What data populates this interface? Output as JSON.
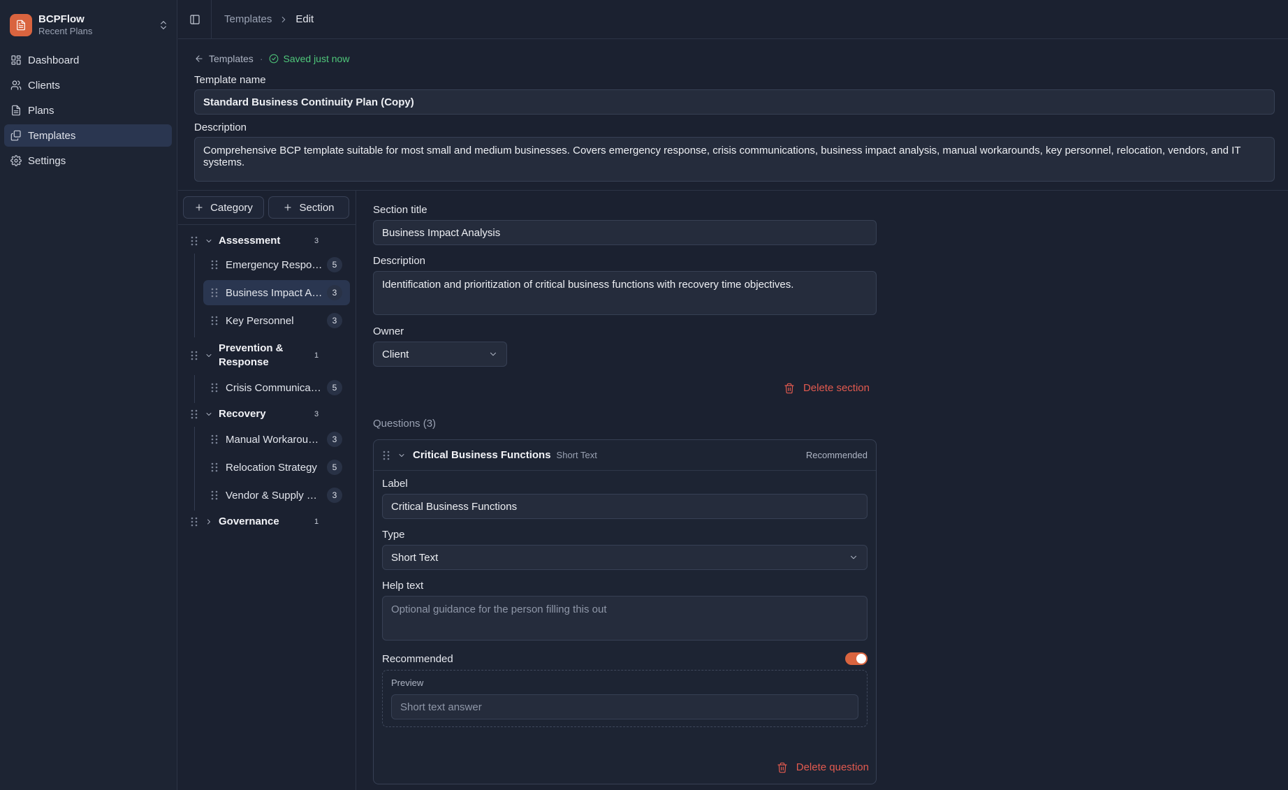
{
  "app": {
    "name": "BCPFlow",
    "subtitle": "Recent Plans"
  },
  "nav": [
    {
      "label": "Dashboard",
      "icon": "dashboard-icon"
    },
    {
      "label": "Clients",
      "icon": "users-icon"
    },
    {
      "label": "Plans",
      "icon": "document-icon"
    },
    {
      "label": "Templates",
      "icon": "templates-icon"
    },
    {
      "label": "Settings",
      "icon": "gear-icon"
    }
  ],
  "breadcrumb": {
    "parent": "Templates",
    "current": "Edit"
  },
  "header": {
    "back_label": "Templates",
    "saved_status": "Saved just now",
    "name_label": "Template name",
    "name_value": "Standard Business Continuity Plan (Copy)",
    "description_label": "Description",
    "description_value": "Comprehensive BCP template suitable for most small and medium businesses. Covers emergency response, crisis communications, business impact analysis, manual workarounds, key personnel, relocation, vendors, and IT systems."
  },
  "tree": {
    "add_category_label": "Category",
    "add_section_label": "Section",
    "categories": [
      {
        "name": "Assessment",
        "count": "3",
        "sections": [
          {
            "name": "Emergency Response Plan",
            "count": "5"
          },
          {
            "name": "Business Impact Analysis",
            "count": "3"
          },
          {
            "name": "Key Personnel",
            "count": "3"
          }
        ]
      },
      {
        "name": "Prevention & Response",
        "count": "1",
        "sections": [
          {
            "name": "Crisis Communications",
            "count": "5"
          }
        ]
      },
      {
        "name": "Recovery",
        "count": "3",
        "sections": [
          {
            "name": "Manual Workarounds",
            "count": "3"
          },
          {
            "name": "Relocation Strategy",
            "count": "5"
          },
          {
            "name": "Vendor & Supply Chain",
            "count": "3"
          }
        ]
      },
      {
        "name": "Governance",
        "count": "1",
        "sections": []
      }
    ]
  },
  "section_editor": {
    "title_label": "Section title",
    "title_value": "Business Impact Analysis",
    "description_label": "Description",
    "description_value": "Identification and prioritization of critical business functions with recovery time objectives.",
    "owner_label": "Owner",
    "owner_value": "Client",
    "delete_label": "Delete section",
    "questions_heading": "Questions (3)"
  },
  "question": {
    "title": "Critical Business Functions",
    "type_badge": "Short Text",
    "recommended_badge": "Recommended",
    "label_label": "Label",
    "label_value": "Critical Business Functions",
    "type_label": "Type",
    "type_value": "Short Text",
    "help_label": "Help text",
    "help_placeholder": "Optional guidance for the person filling this out",
    "recommended_label": "Recommended",
    "recommended_on": true,
    "preview_label": "Preview",
    "preview_placeholder": "Short text answer",
    "delete_label": "Delete question"
  },
  "colors": {
    "accent": "#d9643f",
    "success": "#4fc77a",
    "danger": "#e25a4f"
  }
}
